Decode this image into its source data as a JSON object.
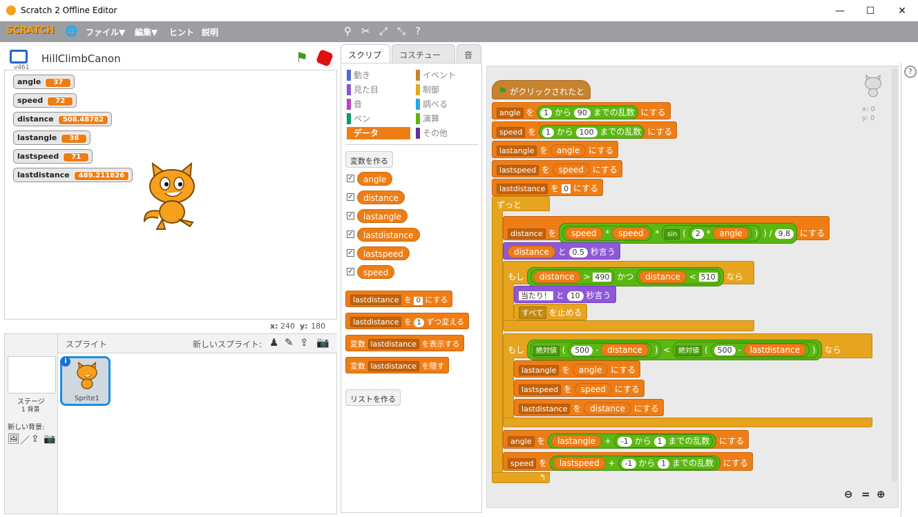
{
  "window": {
    "title": "Scratch 2 Offline Editor",
    "minimize": "—",
    "maximize": "☐",
    "close": "✕"
  },
  "menubar": {
    "logo": "SCRATCH",
    "file": "ファイル▼",
    "edit": "編集▼",
    "hints": "ヒント",
    "about": "説明"
  },
  "stage": {
    "project_name": "HillClimbCanon",
    "version": "v461",
    "coords_x_label": "x:",
    "coords_x": "240",
    "coords_y_label": "y:",
    "coords_y": "180"
  },
  "monitors": [
    {
      "name": "angle",
      "value": "37"
    },
    {
      "name": "speed",
      "value": "72"
    },
    {
      "name": "distance",
      "value": "508.48782"
    },
    {
      "name": "lastangle",
      "value": "36"
    },
    {
      "name": "lastspeed",
      "value": "71"
    },
    {
      "name": "lastdistance",
      "value": "489.211826"
    }
  ],
  "sprites": {
    "header": "スプライト",
    "new_sprite": "新しいスプライト:",
    "stage_label": "ステージ",
    "stage_sub": "1 背景",
    "new_backdrop": "新しい背景:",
    "sprite1": "Sprite1"
  },
  "tabs": {
    "scripts": "スクリプト",
    "costumes": "コスチューム",
    "sounds": "音"
  },
  "categories": [
    {
      "name": "動き",
      "color": "#4a6cd4"
    },
    {
      "name": "イベント",
      "color": "#c88330"
    },
    {
      "name": "見た目",
      "color": "#8a55d7"
    },
    {
      "name": "制御",
      "color": "#e1a91a"
    },
    {
      "name": "音",
      "color": "#bb42c3"
    },
    {
      "name": "調べる",
      "color": "#2ca5e2"
    },
    {
      "name": "ペン",
      "color": "#0e9a6c"
    },
    {
      "name": "演算",
      "color": "#5cb712"
    },
    {
      "name": "データ",
      "color": "#ee7d16"
    },
    {
      "name": "その他",
      "color": "#632d99"
    }
  ],
  "palette": {
    "make_var": "変数を作る",
    "vars": [
      "angle",
      "distance",
      "lastangle",
      "lastdistance",
      "lastspeed",
      "speed"
    ],
    "set_var": "lastdistance",
    "set_to": "を",
    "set_val": "0",
    "set_end": "にする",
    "change_var": "lastdistance",
    "change_to": "を",
    "change_val": "1",
    "change_end": "ずつ変える",
    "show_pre": "変数",
    "show_var": "lastdistance",
    "show_end": "を表示する",
    "hide_pre": "変数",
    "hide_var": "lastdistance",
    "hide_end": "を隠す",
    "make_list": "リストを作る"
  },
  "script": {
    "hat": "がクリックされたとき",
    "angle": "angle",
    "speed": "speed",
    "distance": "distance",
    "lastangle": "lastangle",
    "lastspeed": "lastspeed",
    "lastdistance": "lastdistance",
    "wo": "を",
    "kara": "から",
    "made": "までの乱数",
    "nisuru": "にする",
    "to": "と",
    "byo": "秒言う",
    "r1a": "1",
    "r1b": "90",
    "r2a": "1",
    "r2b": "100",
    "zero": "0",
    "forever": "ずっと",
    "sin": "sin",
    "two": "2",
    "div": "9.8",
    "mul": "*",
    "slash": "/",
    "open": "(",
    "close": ")",
    "plus": "+",
    "minus": "-",
    "say_val": "0.5",
    "if": "もし",
    "then": "なら",
    "and": "かつ",
    "gt": ">",
    "lt": "<",
    "v490": "490",
    "v510": "510",
    "hit": "当たり！",
    "hit_secs": "10",
    "stop_all": "すべて",
    "stop_txt": "を止める",
    "abs": "絶対値",
    "v500a": "500",
    "v500b": "500",
    "neg1a": "-1",
    "one_a": "1",
    "neg1b": "-1",
    "one_b": "1",
    "sprite_x": "x: 0",
    "sprite_y": "y: 0"
  }
}
